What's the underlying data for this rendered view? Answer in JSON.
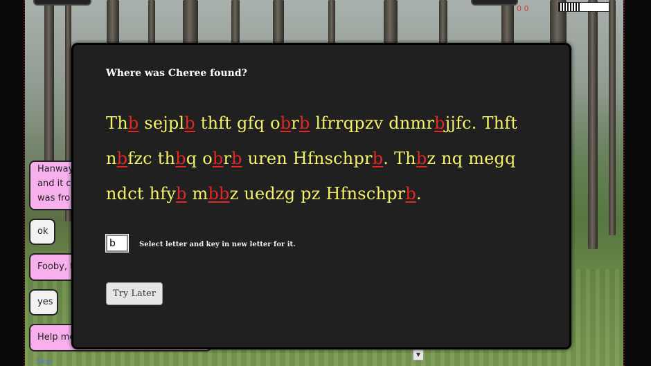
{
  "hud": {
    "energy_level": 0.45,
    "counter_text": "0 0"
  },
  "chat": {
    "bubbles": [
      {
        "lines": [
          "Hanway",
          "and it c",
          "was fro"
        ],
        "style": "pink"
      },
      {
        "lines": [
          "ok"
        ],
        "style": "white"
      },
      {
        "lines": [
          "Fooby, t"
        ],
        "style": "pink"
      },
      {
        "lines": [
          "yes"
        ],
        "style": "white"
      },
      {
        "lines": [
          "Help me"
        ],
        "style": "pink"
      }
    ],
    "link_text": "Skip"
  },
  "puzzle": {
    "question": "Where was Cheree found?",
    "cipher_words": [
      [
        [
          "Th",
          0
        ],
        [
          "b",
          1
        ]
      ],
      [
        [
          "sejpl",
          0
        ],
        [
          "b",
          1
        ]
      ],
      [
        [
          "thft",
          0
        ]
      ],
      [
        [
          "gfq",
          0
        ]
      ],
      [
        [
          "o",
          0
        ],
        [
          "b",
          1
        ],
        [
          "r",
          0
        ],
        [
          "b",
          1
        ]
      ],
      [
        [
          "lfrrqpzv",
          0
        ]
      ],
      [
        [
          "dnmr",
          0
        ],
        [
          "b",
          1
        ],
        [
          "jjfc",
          0
        ],
        [
          ".",
          2
        ]
      ],
      [
        [
          "Thft",
          0
        ]
      ],
      [
        [
          "n",
          0
        ],
        [
          "b",
          1
        ],
        [
          "fzc",
          0
        ]
      ],
      [
        [
          "th",
          0
        ],
        [
          "b",
          1
        ],
        [
          "q",
          0
        ]
      ],
      [
        [
          "o",
          0
        ],
        [
          "b",
          1
        ],
        [
          "r",
          0
        ],
        [
          "b",
          1
        ]
      ],
      [
        [
          "uren",
          0
        ]
      ],
      [
        [
          "Hfnschpr",
          0
        ],
        [
          "b",
          1
        ],
        [
          ".",
          2
        ]
      ],
      [
        [
          "Th",
          0
        ],
        [
          "b",
          1
        ],
        [
          "z",
          0
        ]
      ],
      [
        [
          "nq",
          0
        ]
      ],
      [
        [
          "megq",
          0
        ]
      ],
      [
        [
          "ndct",
          0
        ]
      ],
      [
        [
          "hfy",
          0
        ],
        [
          "b",
          1
        ]
      ],
      [
        [
          "m",
          0
        ],
        [
          "bb",
          1
        ],
        [
          "z",
          0
        ]
      ],
      [
        [
          "uedzg",
          0
        ]
      ],
      [
        [
          "pz",
          0
        ]
      ],
      [
        [
          "Hfnschpr",
          0
        ],
        [
          "b",
          1
        ],
        [
          ".",
          2
        ]
      ]
    ],
    "input_value": "b",
    "hint": "Select letter and key in new letter for it.",
    "try_later_label": "Try Later",
    "colors": {
      "cipher": "#f4f16a",
      "selected_letter": "#e32626"
    }
  }
}
